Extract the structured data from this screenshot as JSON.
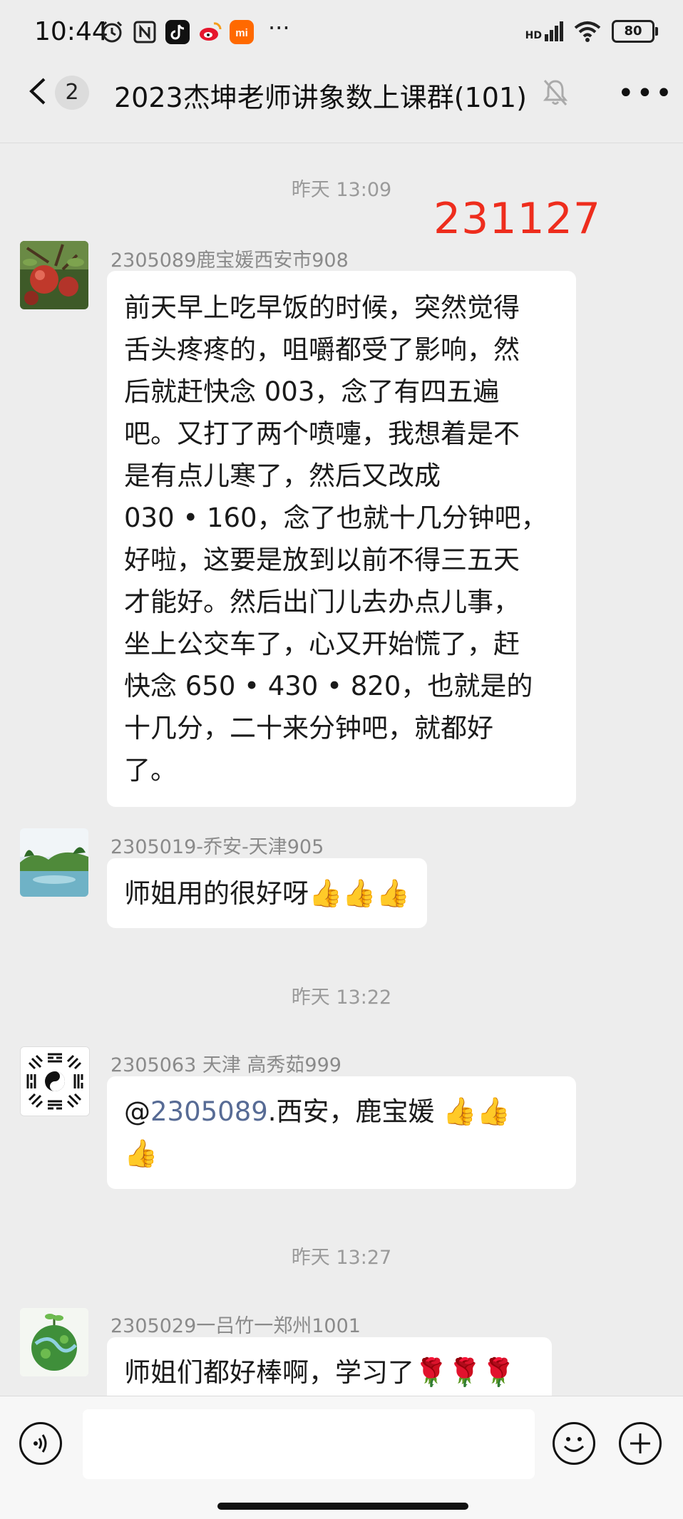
{
  "status_bar": {
    "time": "10:44",
    "left_icons": [
      "alarm-icon",
      "nfc-icon",
      "tiktok-icon",
      "weibo-icon",
      "mi-icon"
    ],
    "more_indicator": "···",
    "network": "HD",
    "battery": "80"
  },
  "header": {
    "unread_count": "2",
    "title": "2023杰坤老师讲象数上课群(101)",
    "muted": true
  },
  "stamp": "231127",
  "timestamps": [
    "昨天 13:09",
    "昨天 13:22",
    "昨天 13:27"
  ],
  "messages": [
    {
      "sender": "2305089鹿宝媛西安市908",
      "avatar": "apple-tree-avatar",
      "lines": [
        "前天早上吃早饭的时候，突然觉得",
        "舌头疼疼的，咀嚼都受了影响，然",
        "后就赶快念 003，念了有四五遍",
        "吧。又打了两个喷嚏，我想着是不",
        "是有点儿寒了，然后又改成",
        "030 • 160，念了也就十几分钟吧，",
        "好啦，这要是放到以前不得三五天",
        "才能好。然后出门儿去办点儿事，",
        "坐上公交车了，心又开始慌了，赶",
        "快念 650 • 430 • 820，也就是的",
        "十几分，二十来分钟吧，就都好",
        "了。"
      ]
    },
    {
      "sender": "2305019-乔安-天津905",
      "avatar": "landscape-avatar",
      "text": "师姐用的很好呀",
      "emojis": "👍👍👍"
    },
    {
      "sender": "2305063  天津  高秀茹999",
      "avatar": "bagua-avatar",
      "mention": "@",
      "mention_id": "2305089",
      "text": ".西安，鹿宝媛 ",
      "emojis_line1": "👍👍",
      "emojis_line2": "👍"
    },
    {
      "sender": "2305029一吕竹一郑州1001",
      "avatar": "green-globe-avatar",
      "text": "师姐们都好棒啊，学习了",
      "emojis": "🌹🌹🌹"
    }
  ],
  "input_bar": {
    "placeholder": ""
  },
  "colors": {
    "background": "#ededed",
    "stamp": "#ee2d1d",
    "mention": "#576b95",
    "bubble": "#ffffff"
  }
}
